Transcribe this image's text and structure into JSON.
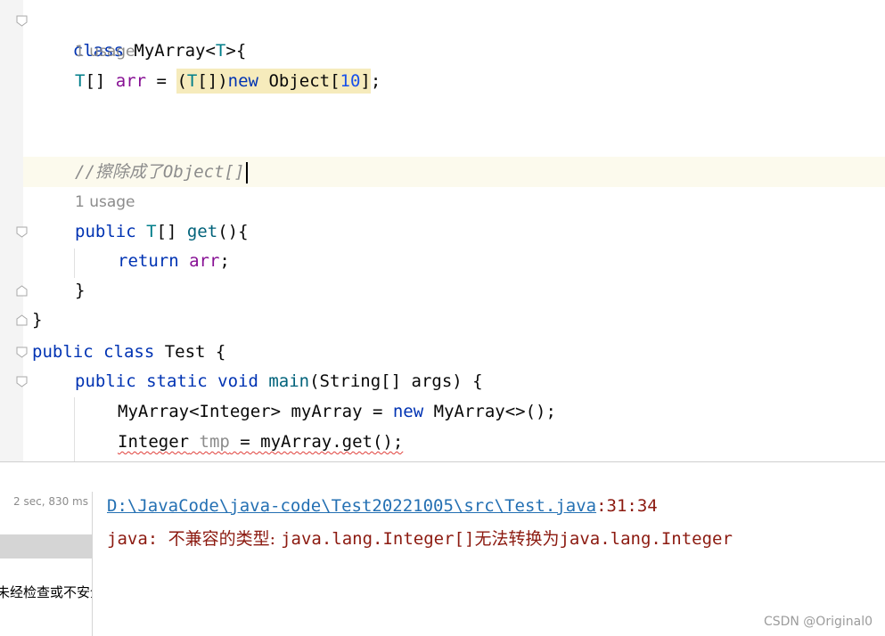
{
  "editor": {
    "hints": {
      "usage_1": "1 usage",
      "usage_2": "1 usage"
    },
    "lines": {
      "l1": {
        "class_kw": "class",
        "name": " MyArray<",
        "tparam": "T",
        "tail": ">{"
      },
      "l2": {
        "type": "T",
        "brackets": "[] ",
        "field": "arr",
        "eq": " = ",
        "cast_open": "(",
        "cast_t": "T",
        "cast_close": "[])",
        "new_kw": "new",
        "obj": " Object[",
        "num": "10",
        "obj_end": "]",
        "semi": ";"
      },
      "l3": {
        "comment_slashes": "//",
        "comment_cjk": "擦除成了",
        "comment_rest": "Object[]"
      },
      "l4": {
        "public_kw": "public",
        "type": " T",
        "brackets": "[] ",
        "method": "get",
        "tail": "(){"
      },
      "l5": {
        "return_kw": "return",
        "field": " arr",
        "semi": ";"
      },
      "l6": {
        "brace": "}"
      },
      "l7": {
        "brace": "}"
      },
      "l8": {
        "public_kw": "public",
        "class_kw": " class",
        "name": " Test {"
      },
      "l9": {
        "kw": "public static void",
        "method": " main",
        "tail": "(String[] args) {"
      },
      "l10": {
        "decl": "MyArray<Integer> myArray = ",
        "new_kw": "new",
        "tail": " MyArray<>();"
      },
      "l11": {
        "type": "Integer",
        "var": " tmp",
        "tail": " = myArray.get();"
      }
    }
  },
  "run_panel": {
    "elapsed": "2 sec, 830 ms",
    "warning_fragment": "未经检查或不安全的"
  },
  "console": {
    "path_link": "D:\\JavaCode\\java-code\\Test20221005\\src\\Test.java",
    "position": ":31:34",
    "err_prefix": "java: ",
    "err_cjk1": "不兼容的类型: ",
    "err_type1": "java.lang.Integer[]",
    "err_cjk2": "无法转换为",
    "err_type2": "java.lang.Integer"
  },
  "watermark": "CSDN @Original0"
}
